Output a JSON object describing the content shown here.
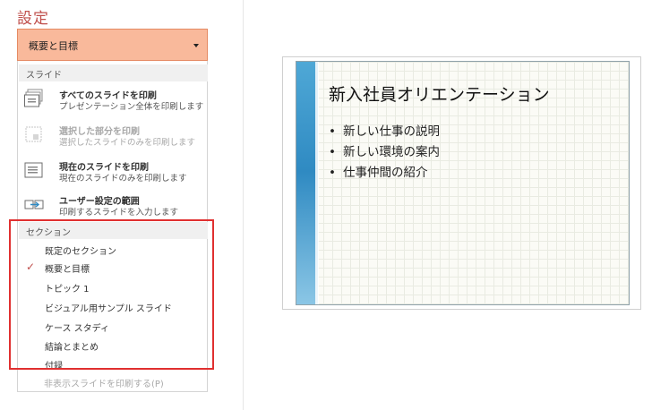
{
  "settings": {
    "title": "設定",
    "dropdown_value": "概要と目標"
  },
  "slides_section": {
    "header": "スライド",
    "options": [
      {
        "title": "すべてのスライドを印刷",
        "subtitle": "プレゼンテーション全体を印刷します",
        "enabled": true
      },
      {
        "title": "選択した部分を印刷",
        "subtitle": "選択したスライドのみを印刷します",
        "enabled": false
      },
      {
        "title": "現在のスライドを印刷",
        "subtitle": "現在のスライドのみを印刷します",
        "enabled": true
      },
      {
        "title": "ユーザー設定の範囲",
        "subtitle": "印刷するスライドを入力します",
        "enabled": true
      }
    ]
  },
  "sections": {
    "header": "セクション",
    "items": [
      {
        "label": "既定のセクション",
        "checked": false
      },
      {
        "label": "概要と目標",
        "checked": true
      },
      {
        "label": "トピック 1",
        "checked": false
      },
      {
        "label": "ビジュアル用サンプル スライド",
        "checked": false
      },
      {
        "label": "ケース スタディ",
        "checked": false
      },
      {
        "label": "結論とまとめ",
        "checked": false
      },
      {
        "label": "付録",
        "checked": false
      }
    ],
    "check_mark": "✓"
  },
  "hidden_slides_label": "非表示スライドを印刷する(P)",
  "preview": {
    "title": "新入社員オリエンテーション",
    "bullets": [
      "新しい仕事の説明",
      "新しい環境の案内",
      "仕事仲間の紹介"
    ],
    "accent_color": "#2f8ac2"
  },
  "colors": {
    "dropdown_bg": "#f9b99b",
    "highlight_box": "#e03030",
    "title_color": "#c0504d"
  }
}
